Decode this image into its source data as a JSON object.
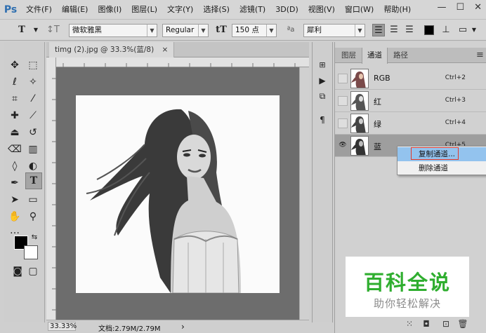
{
  "app": {
    "logo": "Ps"
  },
  "menu": [
    "文件(F)",
    "编辑(E)",
    "图像(I)",
    "图层(L)",
    "文字(Y)",
    "选择(S)",
    "滤镜(T)",
    "3D(D)",
    "视图(V)",
    "窗口(W)",
    "帮助(H)"
  ],
  "window_controls": {
    "minimize": "—",
    "maximize": "☐",
    "close": "✕"
  },
  "options": {
    "font_family": "微软雅黑",
    "font_style": "Regular",
    "font_size": "150 点",
    "aa_label": "ªa",
    "antialias": "犀利"
  },
  "document": {
    "tab_title": "timg (2).jpg @ 33.3%(蓝/8)",
    "close": "×"
  },
  "status": {
    "zoom": "33.33%",
    "doc_info": "文档:2.79M/2.79M",
    "arrow": "›"
  },
  "panel": {
    "tabs": [
      "图层",
      "通道",
      "路径"
    ],
    "active_tab": "通道",
    "menu_icon": "≡",
    "channels": [
      {
        "name": "RGB",
        "shortcut": "Ctrl+2",
        "visible": false,
        "selected": false
      },
      {
        "name": "红",
        "shortcut": "Ctrl+3",
        "visible": false,
        "selected": false
      },
      {
        "name": "绿",
        "shortcut": "Ctrl+4",
        "visible": false,
        "selected": false
      },
      {
        "name": "蓝",
        "shortcut": "Ctrl+5",
        "visible": true,
        "selected": true
      }
    ]
  },
  "context_menu": {
    "items": [
      "复制通道...",
      "删除通道"
    ],
    "hovered": "复制通道..."
  },
  "watermark": {
    "title": "百科全说",
    "subtitle": "助你轻松解决"
  },
  "colors": {
    "accent_blue": "#2f6fb0",
    "hover_blue": "#93c3ee",
    "highlight_red": "#e0392b",
    "watermark_green": "#2fae2f"
  }
}
